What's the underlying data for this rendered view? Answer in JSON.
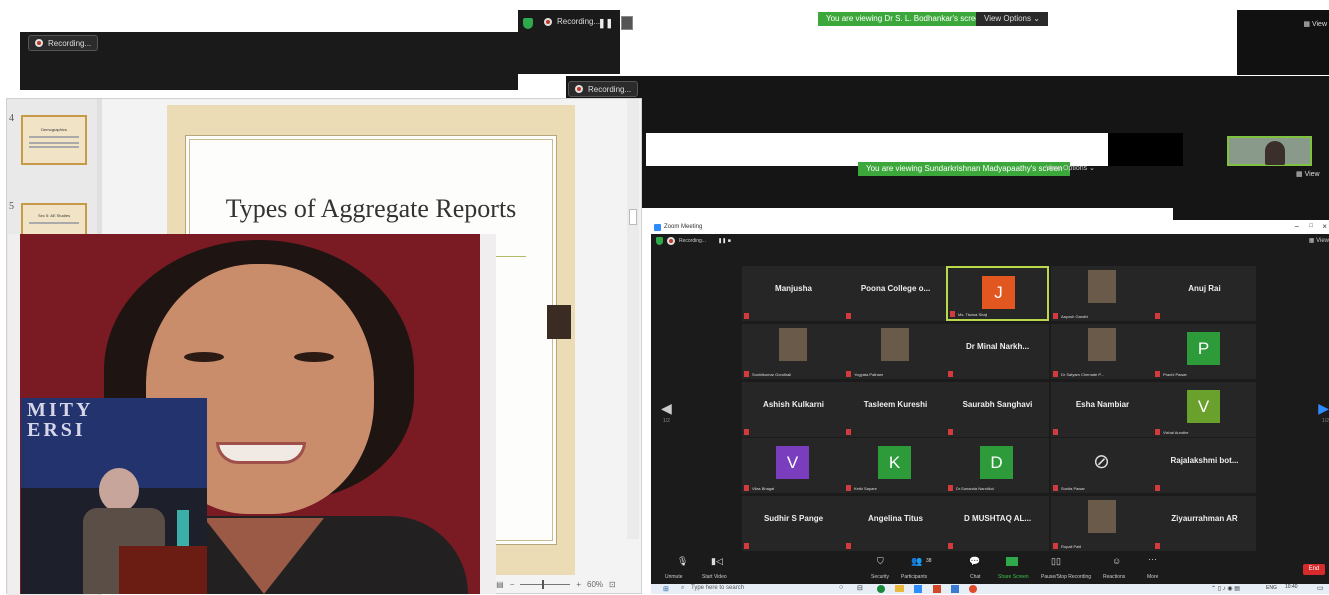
{
  "recording": {
    "label": "Recording..."
  },
  "window_b": {
    "viewing_banner": "You are viewing Dr S. L. Bodhankar's screen",
    "view_options": "View Options ⌄",
    "view_label": "View"
  },
  "window_d": {
    "viewing_banner": "You are viewing Sundarkrishnan Madyapaathy's screen",
    "view_options": "View Options ⌄",
    "view_label": "View"
  },
  "slides": {
    "thumb_numbers": [
      "4",
      "5"
    ],
    "thumb_4_title": "Demographics",
    "thumb_5_title": "Sec 5: AE Studies",
    "main_title": "Types of Aggregate Reports",
    "zoom_level": "60%"
  },
  "photos": {
    "back_sign": "MITY\nERSI"
  },
  "gallery": {
    "window_title": "Zoom Meeting",
    "recording": "Recording...",
    "view_label": "View",
    "page_left": "1/2",
    "page_right": "1/2",
    "tiles": [
      {
        "name": "Manjusha",
        "sub": ""
      },
      {
        "name": "Poona College o...",
        "sub": ""
      },
      {
        "avatar": "J",
        "color": "#e2561f",
        "sub": "Ms. Tiwara Shaji",
        "active": true
      },
      {
        "photo": true,
        "sub": "Aayush Gandhi"
      },
      {
        "name": "Anuj Rai",
        "sub": ""
      },
      {
        "photo": true,
        "sub": "Sushilkumar Gondhali"
      },
      {
        "photo": true,
        "sub": "Yogyata Pathare"
      },
      {
        "name": "Dr Minal Narkh...",
        "sub": ""
      },
      {
        "photo": true,
        "sub": "Dr Satyam Chemate P..."
      },
      {
        "avatar": "P",
        "color": "#2e9b3a",
        "sub": "Prachi Pawar"
      },
      {
        "name": "Ashish Kulkarni",
        "sub": ""
      },
      {
        "name": "Tasleem Kureshi",
        "sub": ""
      },
      {
        "name": "Saurabh Sanghavi",
        "sub": ""
      },
      {
        "name": "Esha Nambiar",
        "sub": ""
      },
      {
        "avatar": "V",
        "color": "#6aa02c",
        "sub": "Vishal Aundhe"
      },
      {
        "avatar": "V",
        "color": "#7a3dbd",
        "sub": "Vilas Bhagat"
      },
      {
        "avatar": "K",
        "color": "#2e9b3a",
        "sub": "Ketki Sapare"
      },
      {
        "avatar": "D",
        "color": "#2e9b3a",
        "sub": "Dr.Sunanda Nandikol"
      },
      {
        "nocam": true,
        "sub": "Sunita Pawar"
      },
      {
        "name": "Rajalakshmi bot...",
        "sub": ""
      },
      {
        "name": "Sudhir S Pange",
        "sub": ""
      },
      {
        "name": "Angelina Titus",
        "sub": ""
      },
      {
        "name": "D MUSHTAQ AL...",
        "sub": ""
      },
      {
        "photo": true,
        "sub": "Rupali Patil"
      },
      {
        "name": "Ziyaurrahman AR",
        "sub": ""
      }
    ],
    "toolbar": {
      "unmute": "Unmute",
      "start_video": "Start Video",
      "security": "Security",
      "participants": "Participants",
      "participants_count": "38",
      "chat": "Chat",
      "share_screen": "Share Screen",
      "pause_recording": "Pause/Stop Recording",
      "reactions": "Reactions",
      "more": "More",
      "end": "End"
    }
  },
  "taskbar": {
    "search_placeholder": "Type here to search",
    "lang": "ENG",
    "time": "10:40"
  }
}
